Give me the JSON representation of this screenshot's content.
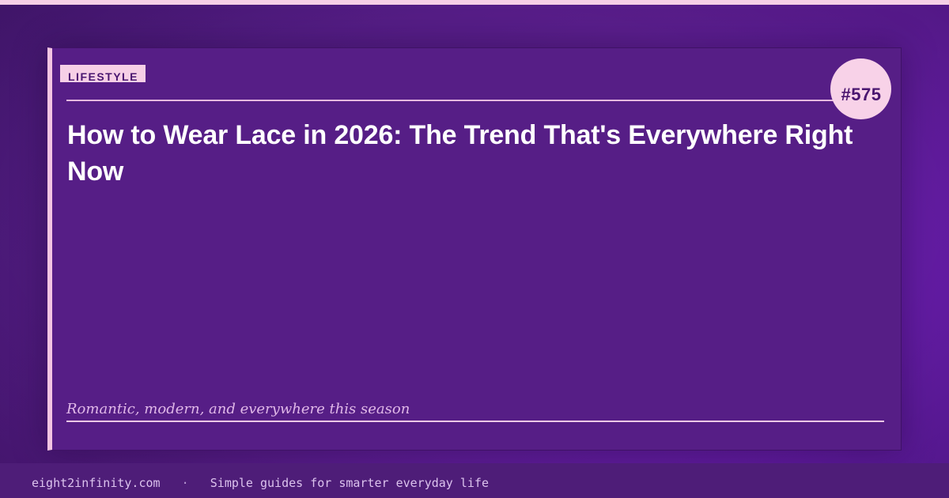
{
  "card": {
    "category": "LIFESTYLE",
    "issue_number": "#575",
    "title": "How to Wear Lace in 2026: The Trend That's Everywhere Right Now",
    "subtitle": "Romantic, modern, and everywhere this season"
  },
  "footer": {
    "site": "eight2infinity.com",
    "separator": "·",
    "tagline": "Simple guides for smarter everyday life"
  },
  "colors": {
    "background": "#561e86",
    "accent_pink": "#f6cfe6",
    "title_text": "#ffffff",
    "subtitle_text": "#e0b8e8"
  }
}
